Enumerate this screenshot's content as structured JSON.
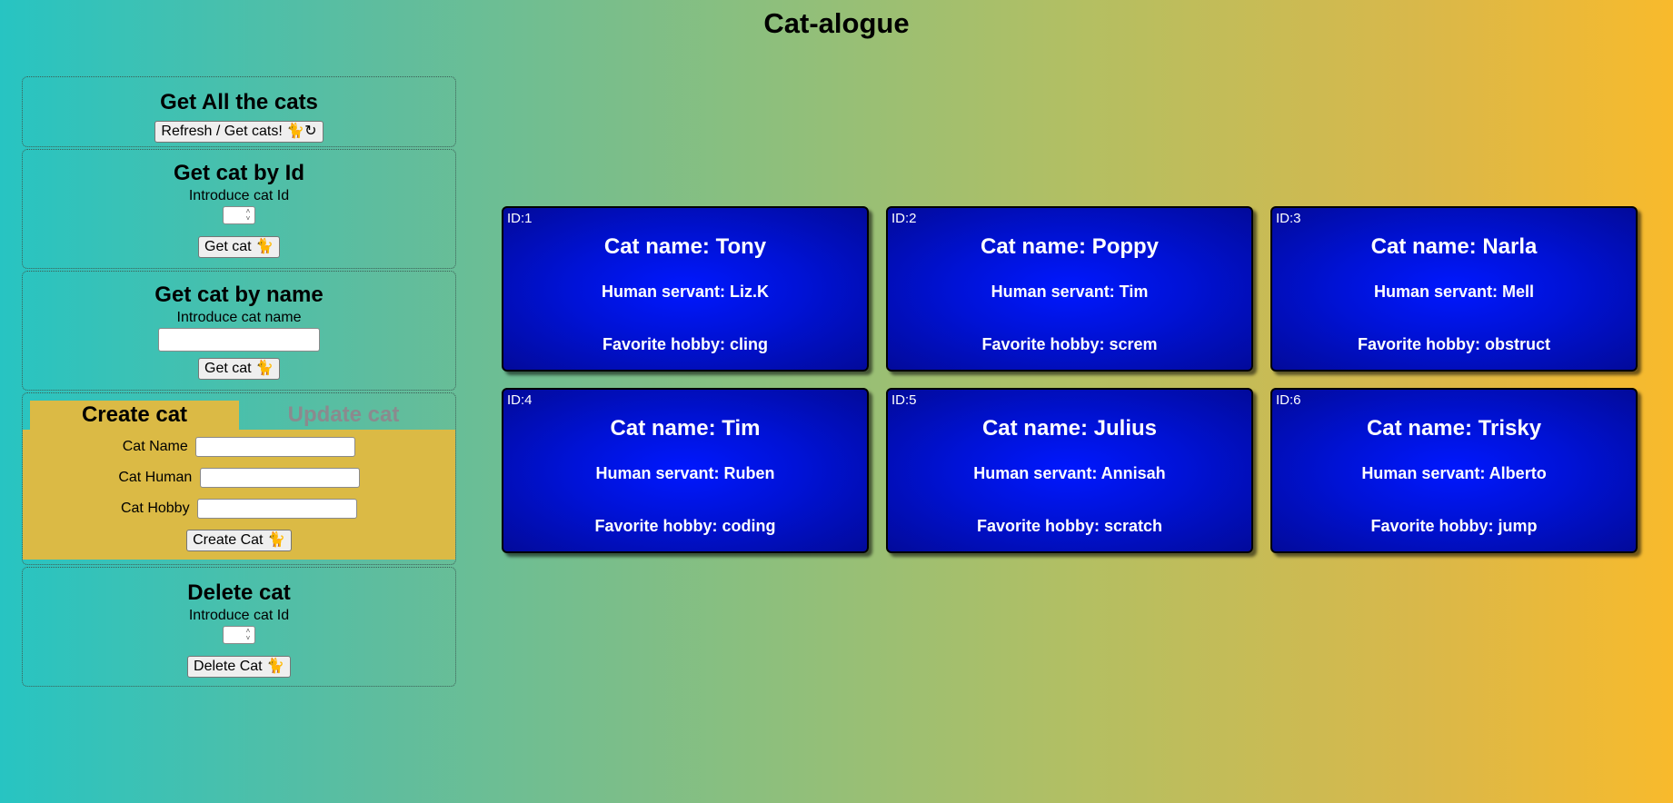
{
  "app": {
    "title": "Cat-alogue"
  },
  "get_all": {
    "title": "Get All the cats",
    "button_label": "Refresh / Get cats!",
    "icons": [
      "cat-icon",
      "refresh-icon"
    ]
  },
  "get_by_id": {
    "title": "Get cat by Id",
    "prompt": "Introduce cat Id",
    "button_label": "Get cat"
  },
  "get_by_name": {
    "title": "Get cat by name",
    "prompt": "Introduce cat name",
    "input_value": "",
    "button_label": "Get cat"
  },
  "create": {
    "tabs": [
      {
        "label": "Create cat",
        "active": true
      },
      {
        "label": "Update cat",
        "active": false
      }
    ],
    "fields": [
      {
        "label": "Cat Name",
        "value": ""
      },
      {
        "label": "Cat Human",
        "value": ""
      },
      {
        "label": "Cat Hobby",
        "value": ""
      }
    ],
    "button_label": "Create Cat"
  },
  "delete": {
    "title": "Delete cat",
    "prompt": "Introduce cat Id",
    "button_label": "Delete Cat"
  },
  "cats": [
    {
      "id": "ID:1",
      "name": "Cat name: Tony",
      "human": "Human servant: Liz.K",
      "hobby": "Favorite hobby: cling"
    },
    {
      "id": "ID:2",
      "name": "Cat name: Poppy",
      "human": "Human servant: Tim",
      "hobby": "Favorite hobby: screm"
    },
    {
      "id": "ID:3",
      "name": "Cat name: Narla",
      "human": "Human servant: Mell",
      "hobby": "Favorite hobby: obstruct"
    },
    {
      "id": "ID:4",
      "name": "Cat name: Tim",
      "human": "Human servant: Ruben",
      "hobby": "Favorite hobby: coding"
    },
    {
      "id": "ID:5",
      "name": "Cat name: Julius",
      "human": "Human servant: Annisah",
      "hobby": "Favorite hobby: scratch"
    },
    {
      "id": "ID:6",
      "name": "Cat name: Trisky",
      "human": "Human servant: Alberto",
      "hobby": "Favorite hobby: jump"
    }
  ],
  "colors": {
    "card_blue": "#0012d6",
    "create_panel": "#dbba45",
    "gradient_start": "#27c4c2",
    "gradient_end": "#f8ba2c"
  }
}
